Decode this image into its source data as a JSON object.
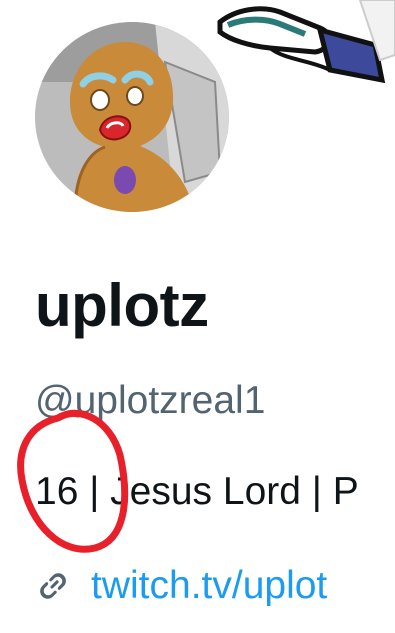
{
  "profile": {
    "display_name": "uplotz",
    "handle": "@uplotzreal1",
    "bio": "16 | Jesus Lord | P",
    "website": "twitch.tv/uplot"
  },
  "avatar": {
    "subject": "gingerbread man"
  },
  "icons": {
    "link": "link-icon"
  },
  "colors": {
    "name": "#0f1419",
    "handle": "#536471",
    "link": "#1d9bf0",
    "annotation": "#e8202a"
  }
}
